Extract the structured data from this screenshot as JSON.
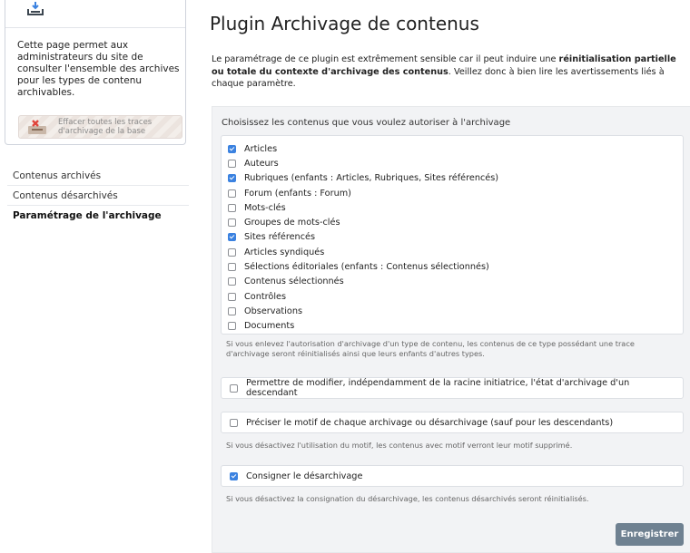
{
  "sidebar": {
    "info_text": "Cette page permet aux administrateurs du site de consulter l'ensemble des archives pour les types de contenu archivables.",
    "erase_button_label": "Effacer toutes les traces d'archivage de la base",
    "nav": [
      {
        "label": "Contenus archivés",
        "active": false
      },
      {
        "label": "Contenus désarchivés",
        "active": false
      },
      {
        "label": "Paramétrage de l'archivage",
        "active": true
      }
    ]
  },
  "page": {
    "title": "Plugin Archivage de contenus",
    "intro_prefix": "Le paramétrage de ce plugin est extrêmement sensible car il peut induire une ",
    "intro_bold": "réinitialisation partielle ou totale du contexte d'archivage des contenus",
    "intro_suffix": ". Veillez donc à bien lire les avertissements liés à chaque paramètre."
  },
  "form": {
    "section_label": "Choisissez les contenus que vous voulez autoriser à l'archivage",
    "content_types": [
      {
        "label": "Articles",
        "checked": true
      },
      {
        "label": "Auteurs",
        "checked": false
      },
      {
        "label": "Rubriques (enfants : Articles, Rubriques, Sites référencés)",
        "checked": true
      },
      {
        "label": "Forum (enfants : Forum)",
        "checked": false
      },
      {
        "label": "Mots-clés",
        "checked": false
      },
      {
        "label": "Groupes de mots-clés",
        "checked": false
      },
      {
        "label": "Sites référencés",
        "checked": true
      },
      {
        "label": "Articles syndiqués",
        "checked": false
      },
      {
        "label": "Sélections éditoriales (enfants : Contenus sélectionnés)",
        "checked": false
      },
      {
        "label": "Contenus sélectionnés",
        "checked": false
      },
      {
        "label": "Contrôles",
        "checked": false
      },
      {
        "label": "Observations",
        "checked": false
      },
      {
        "label": "Documents",
        "checked": false
      }
    ],
    "content_types_help": "Si vous enlevez l'autorisation d'archivage d'un type de contenu, les contenus de ce type possédant une trace d'archivage seront réinitialisés ainsi que leurs enfants d'autres types.",
    "option_descendants": {
      "label": "Permettre de modifier, indépendamment de la racine initiatrice, l'état d'archivage d'un descendant",
      "checked": false
    },
    "option_motif": {
      "label": "Préciser le motif de chaque archivage ou désarchivage (sauf pour les descendants)",
      "checked": false
    },
    "option_motif_help": "Si vous désactivez l'utilisation du motif, les contenus avec motif verront leur motif supprimé.",
    "option_consigner": {
      "label": "Consigner le désarchivage",
      "checked": true
    },
    "option_consigner_help": "Si vous désactivez la consignation du désarchivage, les contenus désarchivés seront réinitialisés.",
    "save_label": "Enregistrer"
  },
  "colors": {
    "accent_checkbox": "#3b82e0",
    "save_button": "#6f8191",
    "panel_background": "#f2f3f5"
  }
}
